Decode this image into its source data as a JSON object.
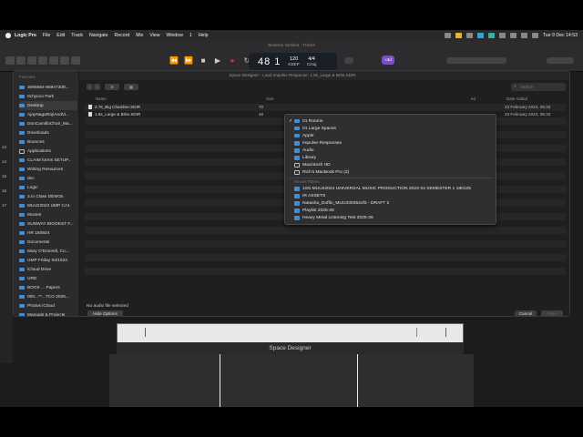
{
  "menubar": {
    "app": "Logic Pro",
    "items": [
      "File",
      "Edit",
      "Track",
      "Navigate",
      "Record",
      "Mix",
      "View",
      "Window",
      "1",
      "Help"
    ],
    "clock": "Tue 9 Dec 14:53"
  },
  "window_title": "Beserno Notides - Tracks",
  "lcd": {
    "bars": "48 1",
    "tempo": "120",
    "tempo_label": "KEEP",
    "sig": "4/4",
    "key": "Cmaj"
  },
  "badge": "≈3d",
  "dialog": {
    "title": "Space Designer - Load Impulse Response: 1.8s_Large & Brite.SDIR",
    "sidebar_header": "Favorites",
    "sidebar": [
      {
        "label": "3066664-969473d9...",
        "kind": "folder"
      },
      {
        "label": "Itchycoo Park",
        "kind": "folder"
      },
      {
        "label": "Desktop",
        "kind": "folder",
        "selected": true
      },
      {
        "label": "AjayNagaRaj\\AndVi...",
        "kind": "folder"
      },
      {
        "label": "DonCamilloChoir_Ma...",
        "kind": "folder"
      },
      {
        "label": "Downloads",
        "kind": "folder"
      },
      {
        "label": "Bounces",
        "kind": "folder"
      },
      {
        "label": "Applications",
        "kind": "app"
      },
      {
        "label": "CLAIM forms SETUP...",
        "kind": "folder"
      },
      {
        "label": "Writing Resources",
        "kind": "folder"
      },
      {
        "label": "doc",
        "kind": "folder"
      },
      {
        "label": "Logic",
        "kind": "folder"
      },
      {
        "label": "3.In Class DEMOs",
        "kind": "folder"
      },
      {
        "label": "MUU22024 UMP CA1",
        "kind": "folder"
      },
      {
        "label": "Movies",
        "kind": "folder"
      },
      {
        "label": "SUNWAY BIGGEST F...",
        "kind": "folder"
      },
      {
        "label": "HR 160924",
        "kind": "folder"
      },
      {
        "label": "Documents",
        "kind": "folder"
      },
      {
        "label": "Mary O'Donnell, Co...",
        "kind": "folder"
      },
      {
        "label": "UMP Friday 04/1024",
        "kind": "folder"
      },
      {
        "label": "iCloud Drive",
        "kind": "folder"
      },
      {
        "label": "URD",
        "kind": "folder"
      },
      {
        "label": "BOOK ... Papers",
        "kind": "folder"
      },
      {
        "label": "000...**...TCO 2025...",
        "kind": "folder"
      },
      {
        "label": "Photos iCloud",
        "kind": "folder"
      },
      {
        "label": "Manuals & Projects",
        "kind": "folder"
      }
    ],
    "search_placeholder": "Search",
    "columns": {
      "name": "Name",
      "size": "Size",
      "kind": "ed",
      "date": "Date Added"
    },
    "files": [
      {
        "name": "2.7s_Big Chamber.SDIR",
        "size": "70",
        "date": "23 February 2024, 05:33"
      },
      {
        "name": "1.8s_Large & Brite.SDIR",
        "size": "48",
        "date": "23 February 2024, 05:33"
      }
    ],
    "status": "No audio file selected",
    "hide_options": "Hide Options",
    "cancel": "Cancel",
    "open": "Open"
  },
  "popup": {
    "locations": [
      {
        "label": "01 Rooms",
        "kind": "folder",
        "checked": true
      },
      {
        "label": "01 Large Spaces",
        "kind": "folder"
      },
      {
        "label": "Apple",
        "kind": "folder"
      },
      {
        "label": "Impulse Responses",
        "kind": "folder"
      },
      {
        "label": "Audio",
        "kind": "folder"
      },
      {
        "label": "Library",
        "kind": "folder"
      },
      {
        "label": "Macintosh HD",
        "kind": "disk"
      },
      {
        "label": "Rich's MacBook Pro (2)",
        "kind": "disk"
      }
    ],
    "recent_header": "Recent Places",
    "recent": [
      "10G.MUU22024 UNIVERSAL MUSIC PRODUCTION 2023-24 SEMESTER 1 180125",
      "IR ASSETS",
      "Natasha_Duffin_MUU330352of3 - DRAFT 2",
      "Playlist 2025-26",
      "Heavy Metal Listening Test 2025-26"
    ]
  },
  "track_numbers": [
    "13",
    "14",
    "15",
    "16",
    "17"
  ],
  "plugin_label": "Space Designer"
}
